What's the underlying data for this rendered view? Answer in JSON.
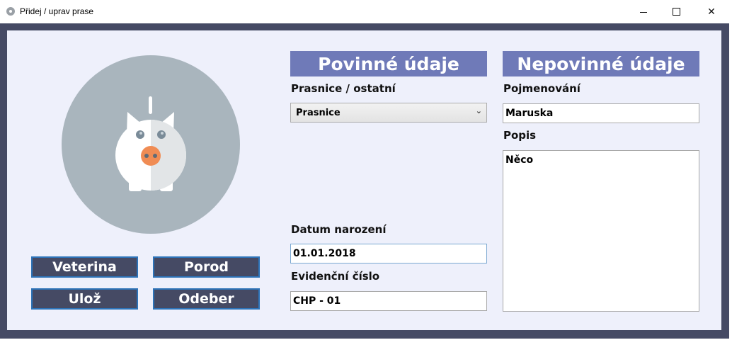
{
  "window": {
    "title": "Přidej / uprav prase",
    "icon": "app-disc-icon",
    "controls": {
      "minimize": "minimize-icon",
      "maximize": "maximize-icon",
      "close": "close-icon",
      "close_glyph": "✕"
    }
  },
  "colors": {
    "frame": "#454a64",
    "panel": "#eef0fb",
    "section_header": "#6f7ab8",
    "button_bg": "#454a64",
    "button_border": "#2d73b8",
    "pig_circle": "#a9b5bd",
    "pig_snout": "#f08c54"
  },
  "illustration": {
    "icon": "piggy-bank-icon"
  },
  "actions": {
    "vet_label": "Veterina",
    "birth_label": "Porod",
    "save_label": "Ulož",
    "remove_label": "Odeber"
  },
  "required": {
    "header": "Povinné údaje",
    "type_label": "Prasnice / ostatní",
    "type_value": "Prasnice",
    "birth_date_label": "Datum narození",
    "birth_date_value": "01.01.2018",
    "reg_number_label": "Evidenční číslo",
    "reg_number_value": "CHP - 01"
  },
  "optional": {
    "header": "Nepovinné údaje",
    "name_label": "Pojmenování",
    "name_value": "Maruska",
    "description_label": "Popis",
    "description_value": "Něco"
  }
}
